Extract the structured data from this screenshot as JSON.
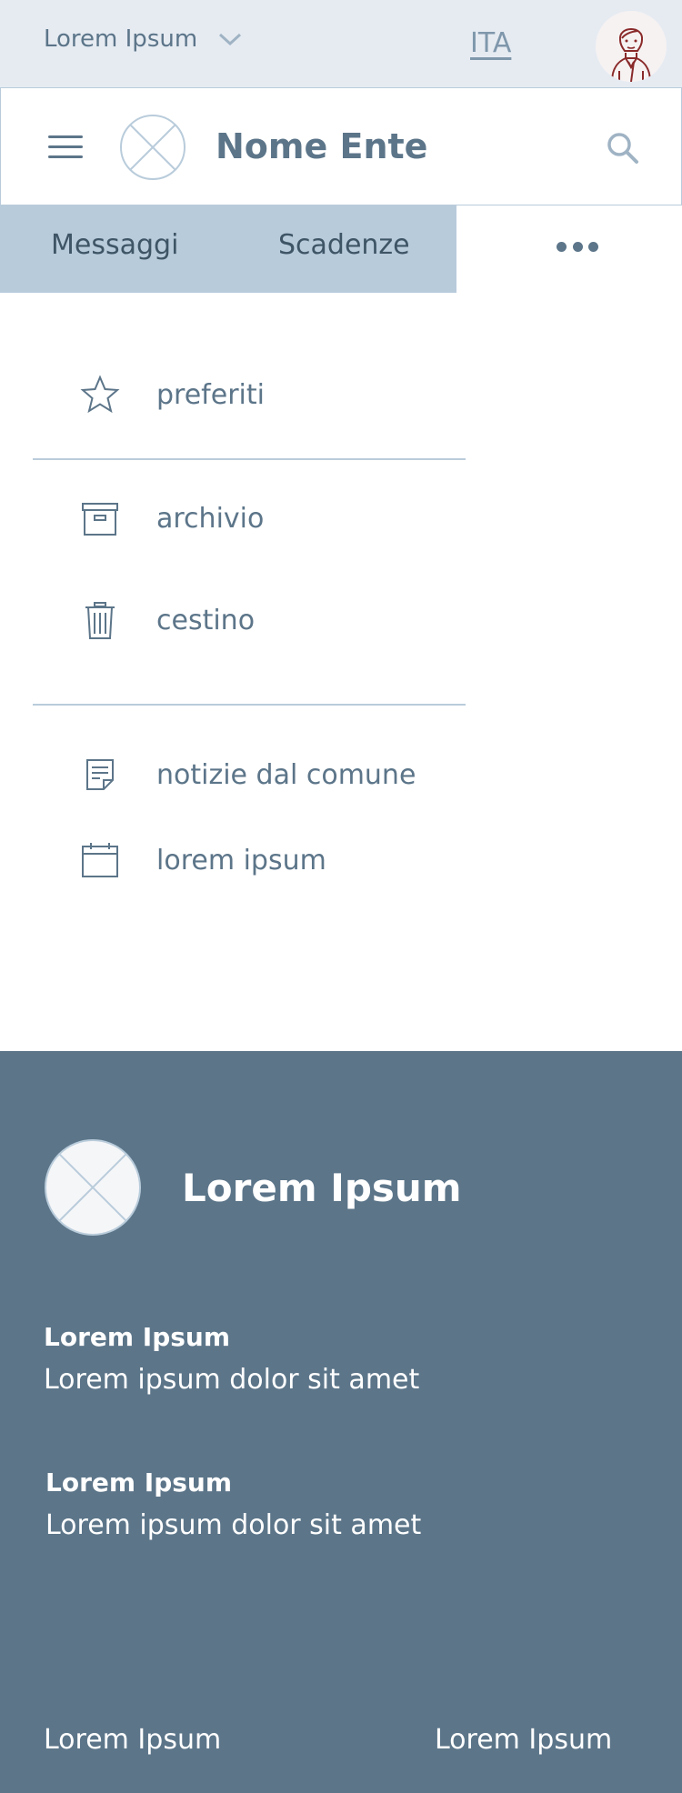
{
  "topbar": {
    "ente_select_label": "Lorem Ipsum",
    "language": "ITA"
  },
  "header": {
    "ente_name": "Nome Ente"
  },
  "tabs": [
    {
      "label": "Messaggi"
    },
    {
      "label": "Scadenze"
    }
  ],
  "menu": {
    "items": [
      {
        "label": "preferiti",
        "icon": "star-icon"
      },
      {
        "label": "archivio",
        "icon": "archive-icon"
      },
      {
        "label": "cestino",
        "icon": "trash-icon"
      },
      {
        "label": "notizie dal comune",
        "icon": "news-icon"
      },
      {
        "label": "lorem ipsum",
        "icon": "calendar-icon"
      }
    ]
  },
  "footer": {
    "title": "Lorem Ipsum",
    "blocks": [
      {
        "title": "Lorem Ipsum",
        "text": "Lorem ipsum dolor sit amet"
      },
      {
        "title": "Lorem Ipsum",
        "text": "Lorem ipsum dolor sit amet"
      }
    ],
    "bottom_links": [
      {
        "label": "Lorem Ipsum"
      },
      {
        "label": "Lorem Ipsum"
      }
    ]
  },
  "colors": {
    "primary": "#5c7589",
    "tab_bg": "#b8cbdb",
    "topbar_bg": "#e6ebf2",
    "border": "#b9ccdb"
  }
}
